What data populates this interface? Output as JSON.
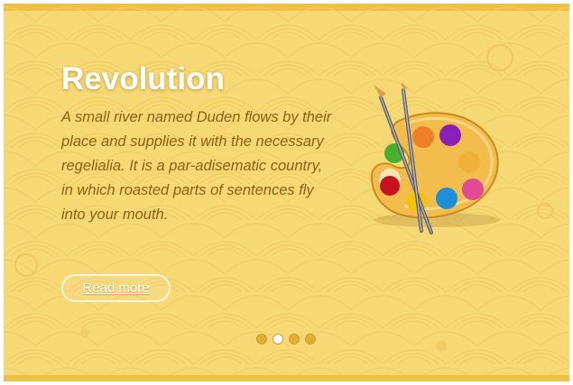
{
  "slide": {
    "title": "Revolution",
    "description": "A small river named Duden flows by their place and supplies it with the necessary regelialia. It is a par-adisematic country, in which roasted parts of sentences fly into your mouth.",
    "button_label": "Read more",
    "image_icon": "paint-palette-icon"
  },
  "pagination": {
    "total": 4,
    "active_index": 1
  },
  "colors": {
    "background": "#f6d874",
    "border": "#efc048",
    "text": "#8a6216",
    "title": "#ffffff"
  }
}
